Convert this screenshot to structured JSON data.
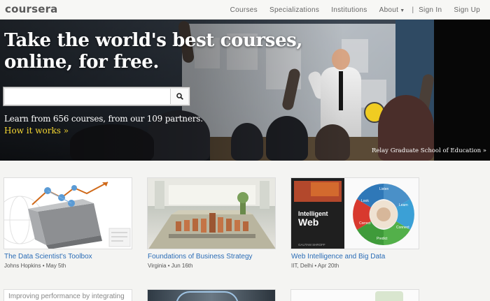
{
  "header": {
    "logo": "coursera",
    "nav": [
      {
        "label": "Courses"
      },
      {
        "label": "Specializations"
      },
      {
        "label": "Institutions"
      },
      {
        "label": "About"
      },
      {
        "label": "Sign In"
      },
      {
        "label": "Sign Up"
      }
    ]
  },
  "hero": {
    "headline": "Take the world's best courses, online, for free.",
    "search_placeholder": "",
    "tagline": "Learn from 656 courses, from our 109 partners.",
    "how_it_works": "How it works »",
    "credit": "Relay Graduate School of Education »"
  },
  "courses": [
    {
      "title": "The Data Scientist's Toolbox",
      "meta": "Johns Hopkins • May 5th"
    },
    {
      "title": "Foundations of Business Strategy",
      "meta": "Virginia • Jun 16th"
    },
    {
      "title": "Web Intelligence and Big Data",
      "meta": "IIT, Delhi • Apr 20th"
    }
  ],
  "thumbs": {
    "book_title_line1": "Intelligent",
    "book_title_line2": "Web",
    "book_author": "GAUTAM SHROFF",
    "cycle": [
      "Listen",
      "Learn",
      "Connect",
      "Predict",
      "Correct",
      "Look"
    ],
    "row2_text": "Improving performance by integrating"
  }
}
